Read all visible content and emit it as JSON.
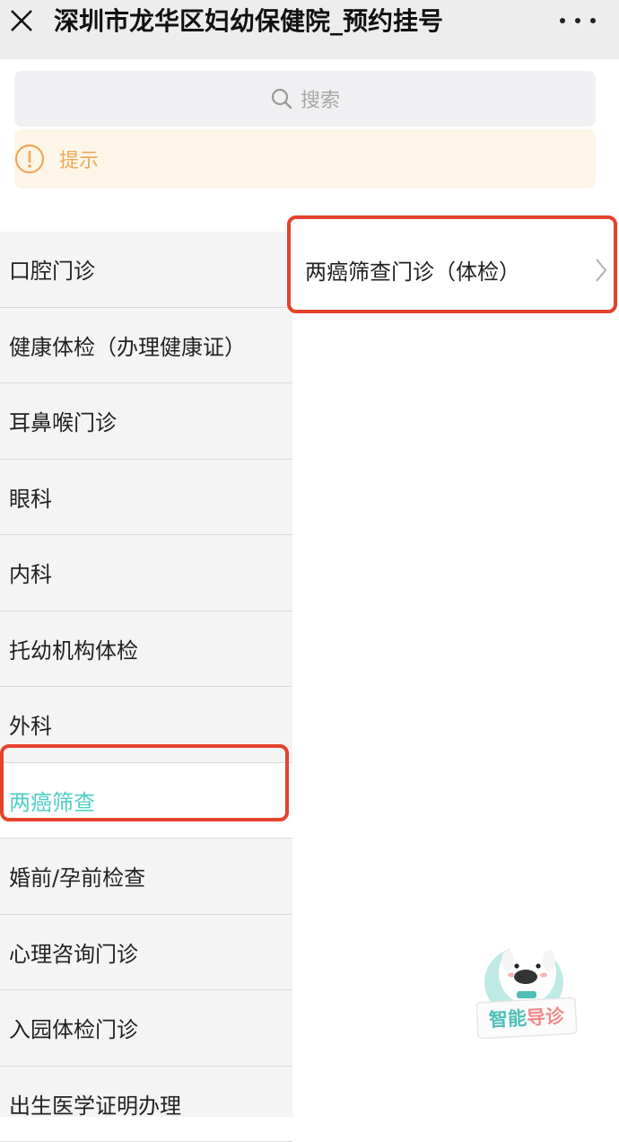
{
  "header": {
    "title": "深圳市龙华区妇幼保健院_预约挂号"
  },
  "search": {
    "placeholder": "搜索"
  },
  "hint": {
    "label": "提示"
  },
  "sidebar": {
    "items": [
      {
        "label": "口腔门诊"
      },
      {
        "label": "健康体检（办理健康证）"
      },
      {
        "label": "耳鼻喉门诊"
      },
      {
        "label": "眼科"
      },
      {
        "label": "内科"
      },
      {
        "label": "托幼机构体检"
      },
      {
        "label": "外科"
      },
      {
        "label": "两癌筛查"
      },
      {
        "label": "婚前/孕前检查"
      },
      {
        "label": "心理咨询门诊"
      },
      {
        "label": "入园体检门诊"
      },
      {
        "label": "出生医学证明办理"
      }
    ],
    "active_index": 7
  },
  "clinics": [
    {
      "label": "两癌筛查门诊（体检）"
    }
  ],
  "assistant": {
    "label_part1": "智能",
    "label_part2": "导诊"
  },
  "colors": {
    "accent": "#4fcfc5",
    "highlight": "#e5422c",
    "hint_text": "#f0a858"
  },
  "icons": [
    "close-icon",
    "more-icon",
    "search-icon",
    "info-icon",
    "chevron-right-icon",
    "mascot-icon"
  ]
}
